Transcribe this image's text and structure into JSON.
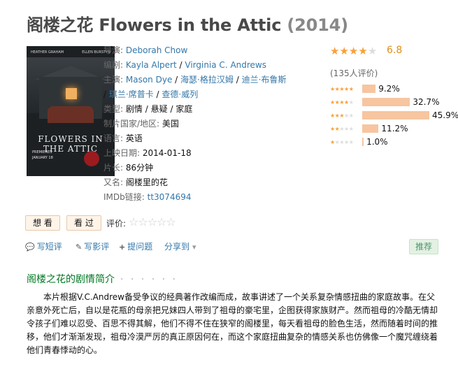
{
  "title": {
    "name": "阁楼之花 Flowers in the Attic",
    "year": "(2014)"
  },
  "poster": {
    "cast_left": "HEATHER GRAHAM",
    "cast_right": "ELLEN BURSTYN",
    "title": "FLOWERS IN THE ATTIC",
    "date_line1": "PREMIERES",
    "date_line2": "JANUARY 18"
  },
  "info": {
    "director_label": "导演:",
    "director": "Deborah Chow",
    "writer_label": "编剧:",
    "writers": [
      "Kayla Alpert",
      "Virginia C. Andrews"
    ],
    "cast_label": "主演:",
    "cast": [
      "Mason Dye",
      "海瑟·格拉汉姆",
      "迪兰·布鲁斯",
      "琪兰·席普卡",
      "查德·威列"
    ],
    "genre_label": "类型:",
    "genres": [
      "剧情",
      "悬疑",
      "家庭"
    ],
    "country_label": "制片国家/地区:",
    "country": "美国",
    "language_label": "语言:",
    "language": "英语",
    "release_label": "上映日期:",
    "release": "2014-01-18",
    "runtime_label": "片长:",
    "runtime": "86分钟",
    "aka_label": "又名:",
    "aka": "阁楼里的花",
    "imdb_label": "IMDb链接:",
    "imdb": "tt3074694",
    "separator": "/"
  },
  "rating": {
    "score": "6.8",
    "stars_value": 3.5,
    "votes": "(135人评价)",
    "breakdown": [
      {
        "stars": 5,
        "percent": 9.2,
        "label": "9.2%"
      },
      {
        "stars": 4,
        "percent": 32.7,
        "label": "32.7%"
      },
      {
        "stars": 3,
        "percent": 45.9,
        "label": "45.9%"
      },
      {
        "stars": 2,
        "percent": 11.2,
        "label": "11.2%"
      },
      {
        "stars": 1,
        "percent": 1.0,
        "label": "1.0%"
      }
    ]
  },
  "actions": {
    "want_label": "想 看",
    "seen_label": "看 过",
    "rate_label": "评价:",
    "short_review": "写短评",
    "review": "写影评",
    "ask": "提问题",
    "share": "分享到",
    "recommend": "推荐"
  },
  "summary": {
    "heading": "阁楼之花的剧情简介",
    "dots": "· · · · · ·",
    "text": "本片根据V.C.Andrew备受争议的经典著作改编而成，故事讲述了一个关系复杂情感扭曲的家庭故事。在父亲意外死亡后，自以是花瓶的母亲把兄妹四人带到了祖母的豪宅里，企图获得家族财产。然而祖母的冷酷无情却令孩子们难以忍受、百思不得其解，他们不得不住在狭窄的阁楼里，每天看祖母的脸色生活，然而随着时间的推移，他们才渐渐发现，祖母冷漠严厉的真正原因何在，而这个家庭扭曲复杂的情感关系也仿佛像一个魔咒缠绕着他们青春悸动的心。"
  },
  "colors": {
    "link": "#3377aa",
    "star": "#f6a13a",
    "score": "#e09015",
    "heading": "#007722",
    "bar": "#f7c5a0"
  }
}
